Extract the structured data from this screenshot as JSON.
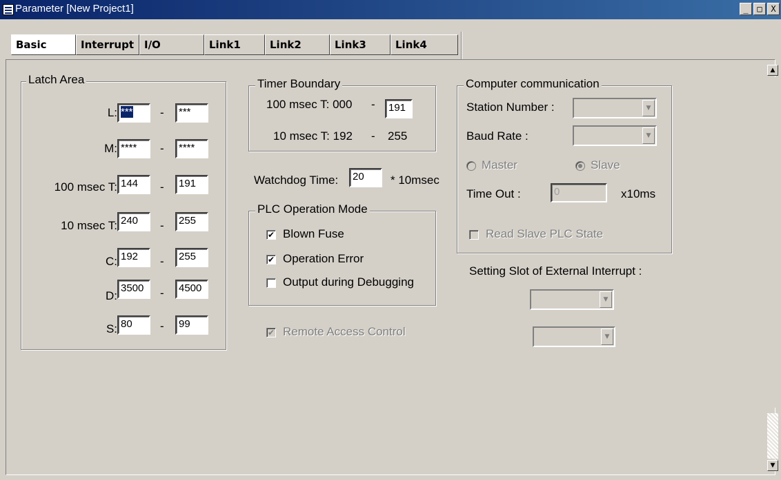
{
  "window": {
    "title": "Parameter [New Project1]",
    "btn_min": "_",
    "btn_max": "□",
    "btn_close": "X"
  },
  "tabs": [
    {
      "label": "Basic",
      "active": true
    },
    {
      "label": "Interrupt",
      "active": false
    },
    {
      "label": "I/O",
      "active": false
    },
    {
      "label": "Link1",
      "active": false
    },
    {
      "label": "Link2",
      "active": false
    },
    {
      "label": "Link3",
      "active": false
    },
    {
      "label": "Link4",
      "active": false
    }
  ],
  "latch_area": {
    "title": "Latch Area",
    "dash": "-",
    "rows": [
      {
        "label": "L:",
        "from": "***",
        "to": "***"
      },
      {
        "label": "M:",
        "from": "****",
        "to": "****"
      },
      {
        "label": "100 msec T:",
        "from": "144",
        "to": "191"
      },
      {
        "label": "10 msec T:",
        "from": "240",
        "to": "255"
      },
      {
        "label": "C:",
        "from": "192",
        "to": "255"
      },
      {
        "label": "D:",
        "from": "3500",
        "to": "4500"
      },
      {
        "label": "S:",
        "from": "80",
        "to": "99"
      }
    ]
  },
  "timer_boundary": {
    "title": "Timer Boundary",
    "row1_label": "100 msec T: 000",
    "dash": "-",
    "row1_value": "191",
    "row2_label": "10 msec T: 192",
    "row2_value": "255"
  },
  "watchdog": {
    "label": "Watchdog Time:",
    "value": "20",
    "unit": "* 10msec"
  },
  "plc_mode": {
    "title": "PLC Operation Mode",
    "options": [
      {
        "label": "Blown Fuse",
        "checked": true
      },
      {
        "label": "Operation Error",
        "checked": true
      },
      {
        "label": "Output during Debugging",
        "checked": false
      }
    ]
  },
  "remote_access": {
    "label": "Remote Access Control",
    "checked": true,
    "enabled": false
  },
  "computer_comm": {
    "title": "Computer communication",
    "station_label": "Station Number :",
    "baud_label": "Baud Rate :",
    "master_label": "Master",
    "slave_label": "Slave",
    "selected_mode": "Slave",
    "timeout_label": "Time Out :",
    "timeout_value": "0",
    "timeout_unit": "x10ms",
    "read_slave_label": "Read Slave PLC State"
  },
  "ext_interrupt": {
    "label": "Setting Slot of External Interrupt :"
  },
  "icons": {
    "check": "✔",
    "arrow_down": "▼",
    "arrow_up": "▲"
  }
}
